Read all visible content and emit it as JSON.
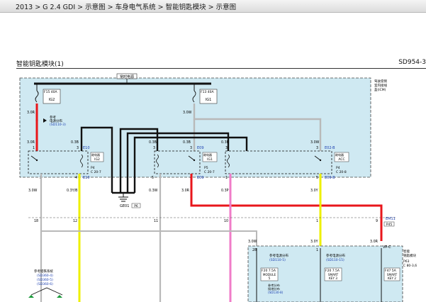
{
  "breadcrumb": "2013 > G 2.4 GDI > 示意图 > 车身电气系统 > 智能钥匙模块 > 示意图",
  "title": "智能钥匙模块(1)",
  "code": "SD954-3",
  "fuse_box": {
    "bus_label": "常时电源",
    "side_note": [
      "驾驶席侧",
      "室内接线",
      "盒(ICM)"
    ],
    "fuses": [
      {
        "id": "F15 40A",
        "name": "IG2"
      },
      {
        "id": "F13 40A",
        "name": "IG1"
      }
    ],
    "power_ref": [
      "参考",
      "电源分布",
      "(SD110-3)"
    ],
    "relays": [
      {
        "label": "继电器",
        "name": "IG2",
        "connector": [
          "P4",
          "C 20-7"
        ]
      },
      {
        "label": "继电器",
        "name": "IG1",
        "connector": [
          "P5",
          "C 20-7"
        ]
      },
      {
        "label": "继电器",
        "name": "ACC",
        "connector": [
          "P4",
          "C 20-8"
        ]
      }
    ],
    "connectors": [
      "E10",
      "E10",
      "E09",
      "E09",
      "E02-B",
      "E09-B"
    ]
  },
  "wire_labels": [
    "3.0R",
    "3.0W",
    "3.0R",
    "0.3B",
    "0.3B",
    "0.3B",
    "0.3B",
    "3.0W",
    "3.0W",
    "0.3Y/B",
    "0.3W",
    "3.0R",
    "0.3P",
    "3.0Y",
    "3.0W",
    "3.0Y",
    "3.0R"
  ],
  "pin_numbers": [
    "1",
    "3",
    "3",
    "3",
    "3",
    "3",
    "2",
    "4",
    "5",
    "4",
    "1",
    "5",
    "6",
    "7",
    "18",
    "12",
    "11",
    "10",
    "1",
    "9",
    "28",
    "1"
  ],
  "ground": {
    "id": "GE01",
    "ref": "P6"
  },
  "em_connector": {
    "id": "EM11",
    "pin": "P45",
    "wire": "VP-C"
  },
  "lower_module": {
    "title": [
      "智能",
      "钥匙模块"
    ],
    "connector": [
      "P63",
      "C 80-3,6"
    ],
    "refs": [
      {
        "text": [
          "参考电源分布",
          "(SD110-5)"
        ]
      },
      {
        "text": [
          "参考电源分布",
          "(SD110-15)"
        ]
      }
    ],
    "fuses": [
      {
        "id": "F20 7.5A",
        "name": [
          "MODULE",
          "5"
        ]
      },
      {
        "id": "F20 7.5A",
        "name": [
          "SMART",
          "KEY 3"
        ]
      },
      {
        "id": "F47 5A",
        "name": [
          "SMART",
          "KEY 2"
        ]
      }
    ],
    "ground_ref": [
      "参考分布",
      "接地分布",
      "(SD130-8)"
    ]
  },
  "left_ref": [
    "参考搭铁系统",
    "(SD360-4)",
    "(SD360-5)",
    "(SD360-6)"
  ],
  "colors": {
    "red": "#e8161b",
    "yellow": "#eef000",
    "pink": "#f07cc8",
    "black": "#111111",
    "gray": "#b9b9b9",
    "panel": "#cfe9f2"
  }
}
